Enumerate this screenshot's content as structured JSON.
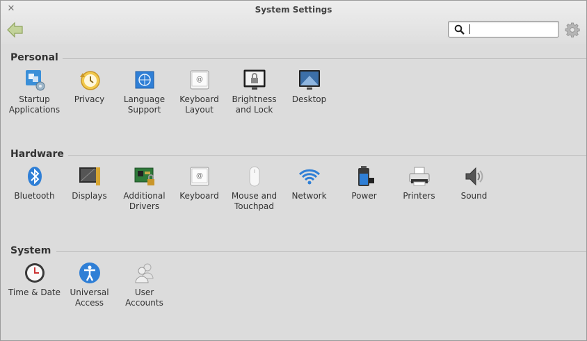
{
  "window": {
    "title": "System Settings"
  },
  "search": {
    "value": "",
    "placeholder": ""
  },
  "sections": [
    {
      "title": "Personal",
      "items": [
        {
          "label": "Startup\nApplications",
          "icon": "startup-applications-icon"
        },
        {
          "label": "Privacy",
          "icon": "privacy-icon"
        },
        {
          "label": "Language\nSupport",
          "icon": "language-support-icon"
        },
        {
          "label": "Keyboard\nLayout",
          "icon": "keyboard-layout-icon"
        },
        {
          "label": "Brightness\nand Lock",
          "icon": "brightness-lock-icon"
        },
        {
          "label": "Desktop",
          "icon": "desktop-icon"
        }
      ]
    },
    {
      "title": "Hardware",
      "items": [
        {
          "label": "Bluetooth",
          "icon": "bluetooth-icon"
        },
        {
          "label": "Displays",
          "icon": "displays-icon"
        },
        {
          "label": "Additional\nDrivers",
          "icon": "additional-drivers-icon"
        },
        {
          "label": "Keyboard",
          "icon": "keyboard-icon"
        },
        {
          "label": "Mouse and\nTouchpad",
          "icon": "mouse-icon"
        },
        {
          "label": "Network",
          "icon": "network-icon"
        },
        {
          "label": "Power",
          "icon": "power-icon"
        },
        {
          "label": "Printers",
          "icon": "printer-icon"
        },
        {
          "label": "Sound",
          "icon": "sound-icon"
        }
      ]
    },
    {
      "title": "System",
      "items": [
        {
          "label": "Time & Date",
          "icon": "clock-icon"
        },
        {
          "label": "Universal\nAccess",
          "icon": "universal-access-icon"
        },
        {
          "label": "User\nAccounts",
          "icon": "user-accounts-icon"
        }
      ]
    }
  ],
  "colors": {
    "accent_blue": "#2f7fd6",
    "back_arrow": "#b8c98a",
    "background": "#dcdcdc"
  }
}
